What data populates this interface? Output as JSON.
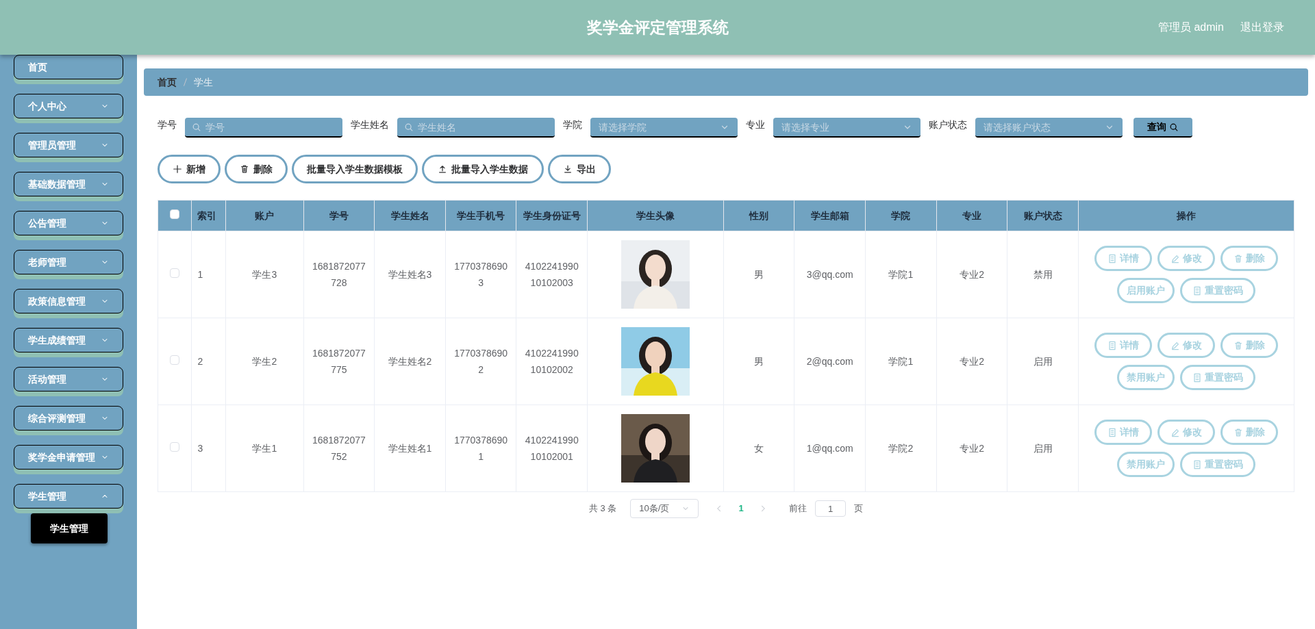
{
  "header": {
    "title": "奖学金评定管理系统",
    "user": "管理员 admin",
    "logout": "退出登录"
  },
  "sidebar": {
    "items": [
      {
        "label": "首页",
        "kind": "link"
      },
      {
        "label": "个人中心",
        "kind": "menu",
        "expanded": false
      },
      {
        "label": "管理员管理",
        "kind": "menu",
        "expanded": false
      },
      {
        "label": "基础数据管理",
        "kind": "menu",
        "expanded": false
      },
      {
        "label": "公告管理",
        "kind": "menu",
        "expanded": false
      },
      {
        "label": "老师管理",
        "kind": "menu",
        "expanded": false
      },
      {
        "label": "政策信息管理",
        "kind": "menu",
        "expanded": false
      },
      {
        "label": "学生成绩管理",
        "kind": "menu",
        "expanded": false
      },
      {
        "label": "活动管理",
        "kind": "menu",
        "expanded": false
      },
      {
        "label": "综合评测管理",
        "kind": "menu",
        "expanded": false
      },
      {
        "label": "奖学金申请管理",
        "kind": "menu",
        "expanded": false
      },
      {
        "label": "学生管理",
        "kind": "menu",
        "expanded": true,
        "children": [
          {
            "label": "学生管理",
            "selected": true
          }
        ]
      }
    ]
  },
  "breadcrumb": [
    "首页",
    "学生"
  ],
  "search": {
    "fields": [
      {
        "label": "学号",
        "kind": "input",
        "placeholder": "学号"
      },
      {
        "label": "学生姓名",
        "kind": "input",
        "placeholder": "学生姓名"
      },
      {
        "label": "学院",
        "kind": "select",
        "placeholder": "请选择学院"
      },
      {
        "label": "专业",
        "kind": "select",
        "placeholder": "请选择专业"
      },
      {
        "label": "账户状态",
        "kind": "select",
        "placeholder": "请选择账户状态"
      }
    ],
    "button": "查询"
  },
  "toolbar": [
    {
      "label": "新增",
      "kind": "add"
    },
    {
      "label": "删除",
      "kind": "delete"
    },
    {
      "label": "批量导入学生数据模板",
      "kind": "plain"
    },
    {
      "label": "批量导入学生数据",
      "kind": "upload"
    },
    {
      "label": "导出",
      "kind": "download"
    }
  ],
  "table": {
    "header_checked": false,
    "columns": [
      "索引",
      "账户",
      "学号",
      "学生姓名",
      "学生手机号",
      "学生身份证号",
      "学生头像",
      "性别",
      "学生邮箱",
      "学院",
      "专业",
      "账户状态",
      "操作"
    ],
    "rows": [
      {
        "checked": false,
        "cells": [
          "1",
          "学生3",
          "1681872077728",
          "学生姓名3",
          "17703786903",
          "410224199010102003",
          "",
          "男",
          "3@qq.com",
          "学院1",
          "专业2",
          "禁用"
        ],
        "actions": [
          "详情",
          "修改",
          "删除",
          "启用账户",
          "重置密码"
        ]
      },
      {
        "checked": false,
        "cells": [
          "2",
          "学生2",
          "1681872077775",
          "学生姓名2",
          "17703786902",
          "410224199010102002",
          "",
          "男",
          "2@qq.com",
          "学院1",
          "专业2",
          "启用"
        ],
        "actions": [
          "详情",
          "修改",
          "删除",
          "禁用账户",
          "重置密码"
        ]
      },
      {
        "checked": false,
        "cells": [
          "3",
          "学生1",
          "1681872077752",
          "学生姓名1",
          "17703786901",
          "410224199010102001",
          "",
          "女",
          "1@qq.com",
          "学院2",
          "专业2",
          "启用"
        ],
        "actions": [
          "详情",
          "修改",
          "删除",
          "禁用账户",
          "重置密码"
        ]
      }
    ]
  },
  "pagination": {
    "total": "共 3 条",
    "page_size": "10条/页",
    "pages": [
      {
        "label": "1",
        "selected": true
      }
    ],
    "goto": "前往",
    "goto_value": "1",
    "unit": "页"
  }
}
